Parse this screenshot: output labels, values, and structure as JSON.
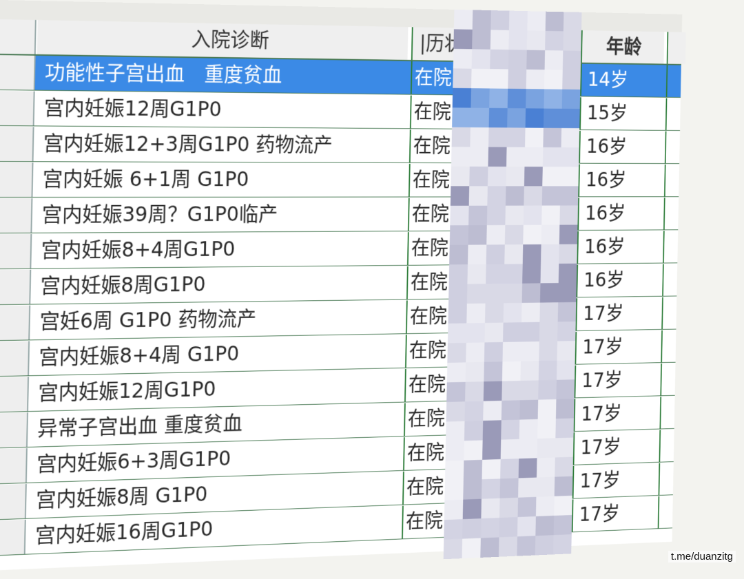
{
  "table": {
    "headers": {
      "diagnosis": "入院诊断",
      "status": "|历状",
      "age": "年龄"
    },
    "rows": [
      {
        "diagnosis": "功能性子宫出血　重度贫血",
        "status": "在院",
        "age": "14岁",
        "selected": true
      },
      {
        "diagnosis": "宫内妊娠12周G1P0",
        "status": "在院",
        "age": "15岁"
      },
      {
        "diagnosis": "宫内妊娠12+3周G1P0 药物流产",
        "status": "在院",
        "age": "16岁"
      },
      {
        "diagnosis": "宫内妊娠 6+1周 G1P0",
        "status": "在院",
        "age": "16岁"
      },
      {
        "diagnosis": "宫内妊娠39周？G1P0临产",
        "status": "在院",
        "age": "16岁"
      },
      {
        "diagnosis": "宫内妊娠8+4周G1P0",
        "status": "在院",
        "age": "16岁"
      },
      {
        "diagnosis": "宫内妊娠8周G1P0",
        "status": "在院",
        "age": "16岁"
      },
      {
        "diagnosis": "宫妊6周 G1P0 药物流产",
        "status": "在院",
        "age": "17岁"
      },
      {
        "diagnosis": "宫内妊娠8+4周 G1P0",
        "status": "在院",
        "age": "17岁"
      },
      {
        "diagnosis": "宫内妊娠12周G1P0",
        "status": "在院",
        "age": "17岁"
      },
      {
        "diagnosis": "异常子宫出血 重度贫血",
        "status": "在院",
        "age": "17岁"
      },
      {
        "diagnosis": "宫内妊娠6+3周G1P0",
        "status": "在院",
        "age": "17岁"
      },
      {
        "diagnosis": "宫内妊娠8周 G1P0",
        "status": "在院",
        "age": "17岁"
      },
      {
        "diagnosis": "宫内妊娠16周G1P0",
        "status": "在院",
        "age": "17岁"
      }
    ]
  },
  "watermark": "t.me/duanzitg",
  "colors": {
    "selection": "#3b8ae6",
    "grid_lines": "#2e7d3a"
  }
}
